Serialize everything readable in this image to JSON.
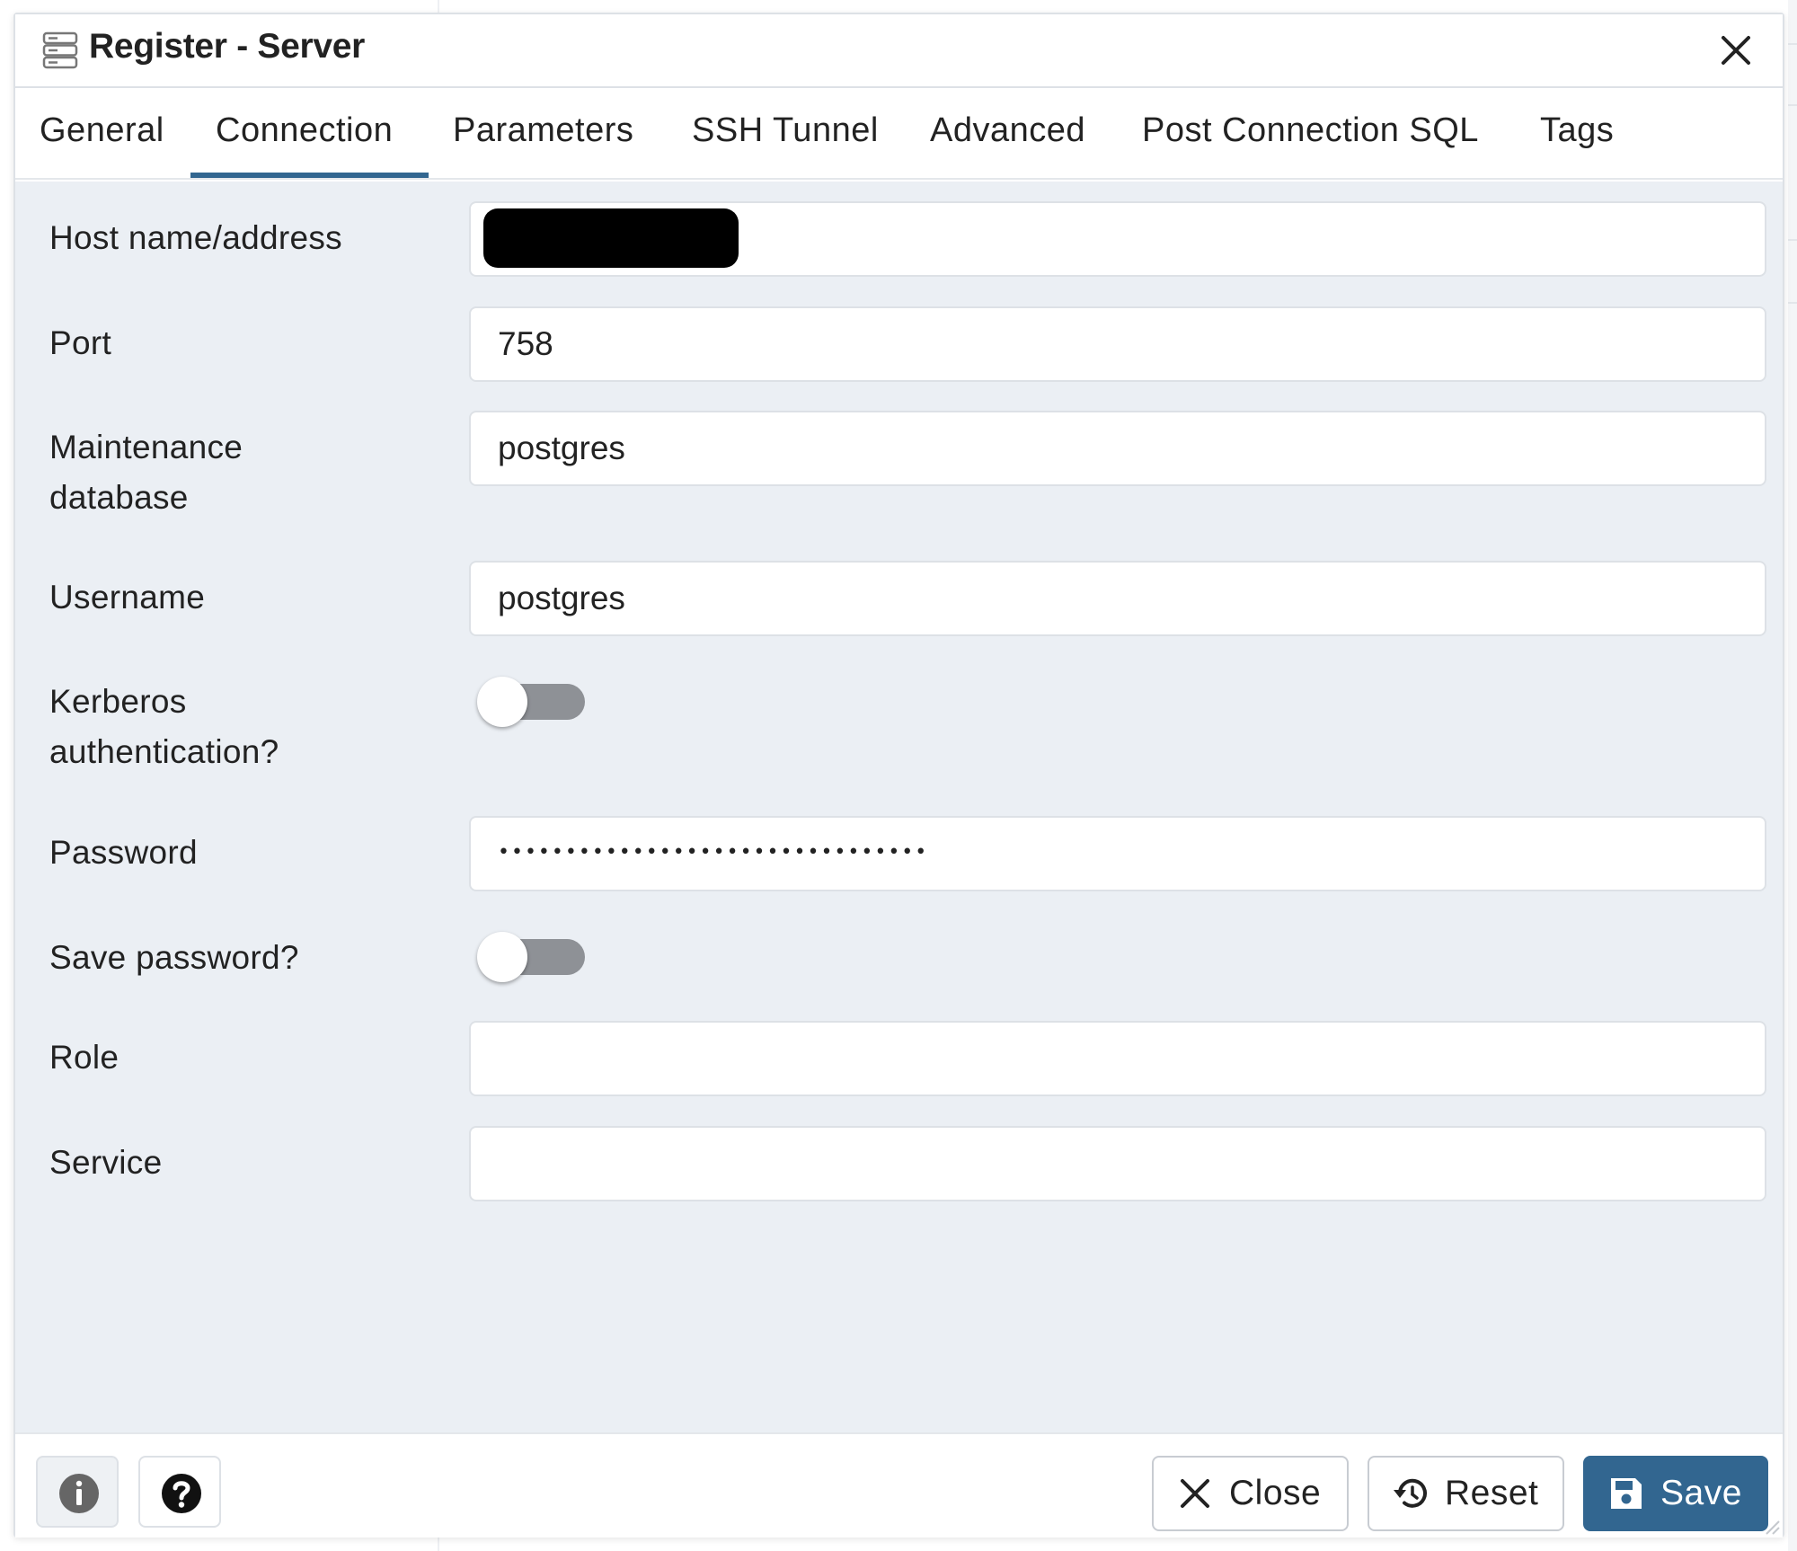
{
  "window": {
    "title": "Register - Server",
    "title_icon": "server-icon",
    "close_icon": "close-icon"
  },
  "tabs": [
    {
      "label": "General",
      "active": false
    },
    {
      "label": "Connection",
      "active": true
    },
    {
      "label": "Parameters",
      "active": false
    },
    {
      "label": "SSH Tunnel",
      "active": false
    },
    {
      "label": "Advanced",
      "active": false
    },
    {
      "label": "Post Connection SQL",
      "active": false
    },
    {
      "label": "Tags",
      "active": false
    }
  ],
  "form": {
    "host": {
      "label": "Host name/address",
      "value": ""
    },
    "port": {
      "label": "Port",
      "value": "758"
    },
    "maintenance_db": {
      "label_line1": "Maintenance",
      "label_line2": "database",
      "value": "postgres"
    },
    "username": {
      "label": "Username",
      "value": "postgres"
    },
    "kerberos": {
      "label_line1": "Kerberos",
      "label_line2": "authentication?",
      "enabled": false
    },
    "password": {
      "label": "Password",
      "value": "••••••••••••••••••••••••••••••••"
    },
    "save_password": {
      "label": "Save password?",
      "enabled": false
    },
    "role": {
      "label": "Role",
      "value": ""
    },
    "service": {
      "label": "Service",
      "value": ""
    }
  },
  "footer": {
    "info_icon": "info-icon",
    "help_icon": "help-icon",
    "close_label": "Close",
    "reset_label": "Reset",
    "save_label": "Save"
  },
  "colors": {
    "accent": "#326690",
    "form_background": "#ebeff4",
    "toggle_off": "#8e9196"
  }
}
